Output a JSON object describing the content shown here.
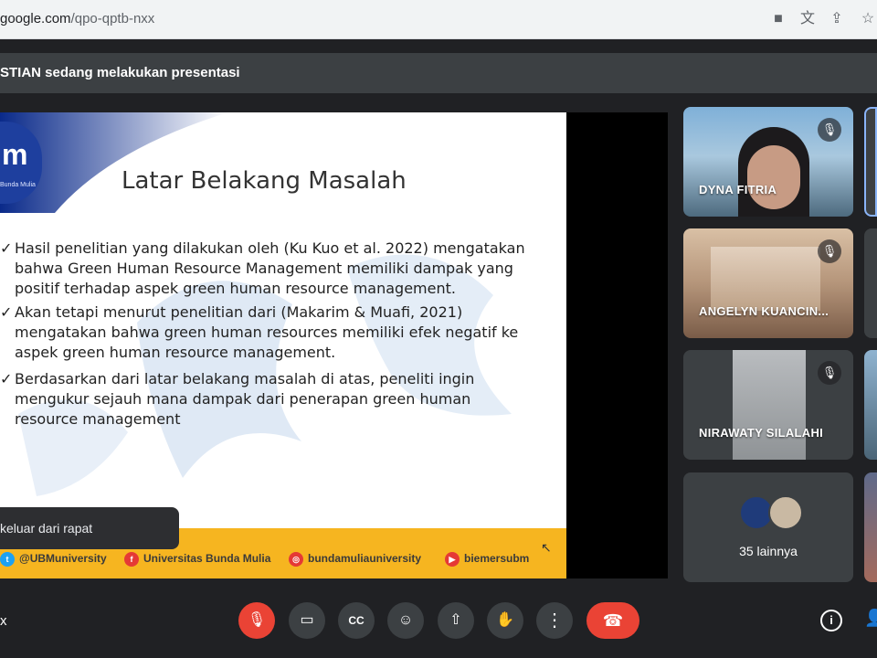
{
  "browser": {
    "url_host": "google.com",
    "url_path": "/qpo-qptb-nxx"
  },
  "presenter_bar": {
    "text": "STIAN sedang melakukan presentasi"
  },
  "slide": {
    "logo_text": "m",
    "logo_sub": "Bunda Mulia",
    "title": "Latar Belakang Masalah",
    "bullets": [
      {
        "lines": [
          "Hasil penelitian yang dilakukan oleh (Ku Kuo et al. 2022) mengatakan",
          "bahwa Green Human Resource Management memiliki dampak yang",
          "positif terhadap aspek green human resource management."
        ]
      },
      {
        "lines": [
          "Akan tetapi menurut penelitian dari (Makarim & Muafi, 2021)",
          "mengatakan bahwa green human resources memiliki efek negatif ke",
          "aspek green human resource management."
        ]
      },
      {
        "lines": [
          "Berdasarkan dari latar belakang masalah di atas, peneliti ingin",
          "mengukur sejauh mana dampak dari penerapan green human",
          "resource management"
        ]
      }
    ],
    "footer": [
      {
        "label": "@UBMuniversity"
      },
      {
        "label": "Universitas Bunda Mulia"
      },
      {
        "label": "bundamuliauniversity"
      },
      {
        "label": "biemersubm"
      }
    ]
  },
  "toast": {
    "text": "keluar dari rapat"
  },
  "participants": [
    {
      "name": "DYNA FITRIA",
      "muted": true
    },
    {
      "name": "ANGELYN KUANCIN...",
      "muted": true
    },
    {
      "name": "NIRAWATY SILALAHI",
      "muted": true
    }
  ],
  "others": {
    "label": "35 lainnya"
  },
  "bottom": {
    "left_label": "x"
  },
  "icons": {
    "mute": "mic-off-icon",
    "camera": "camera-icon",
    "captions": "cc-icon",
    "emoji": "emoji-icon",
    "present": "present-icon",
    "hand": "hand-icon",
    "more": "more-icon",
    "hangup": "hangup-icon",
    "info": "info-icon",
    "people": "people-icon"
  },
  "colors": {
    "red": "#ea4335",
    "footer": "#f6b520",
    "control": "#3c4043",
    "background": "#202124"
  }
}
